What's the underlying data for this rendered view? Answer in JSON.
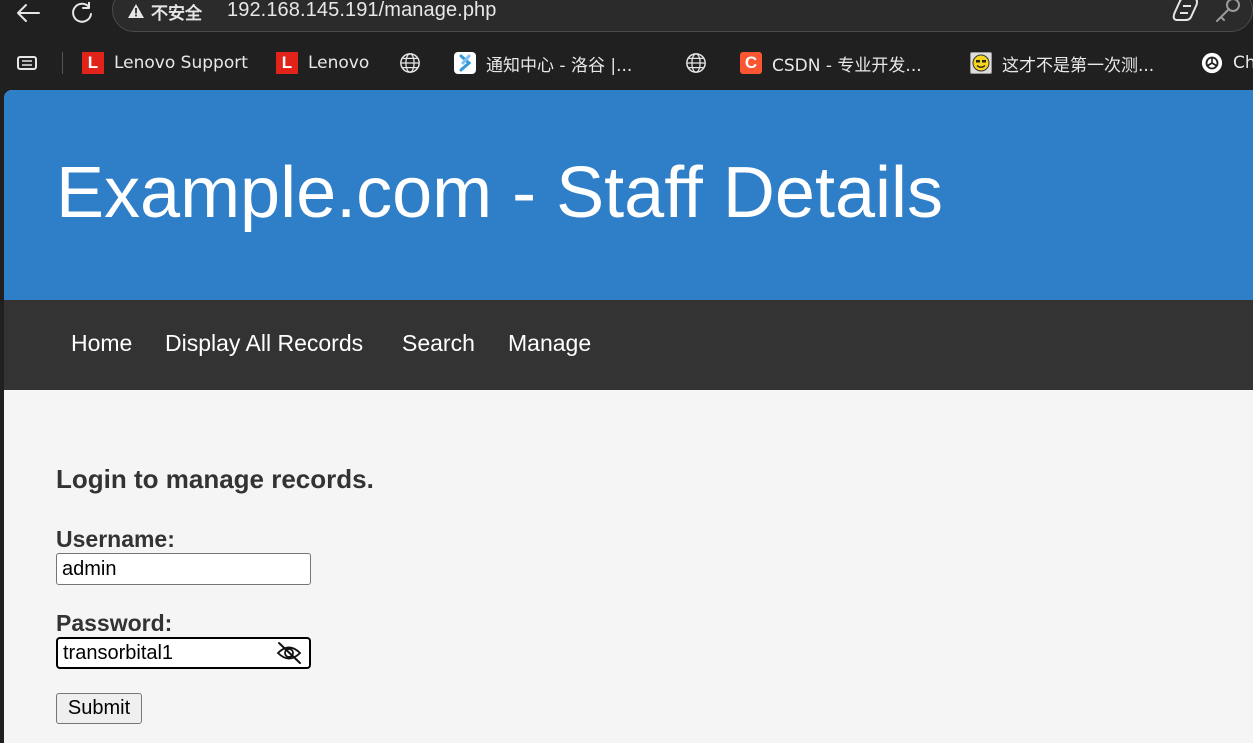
{
  "browser": {
    "security_label": "不安全",
    "url": "192.168.145.191/manage.php",
    "icons": {
      "back": "back-arrow-icon",
      "reload": "reload-icon",
      "warning": "warning-triangle-icon",
      "copilot": "copilot-icon",
      "password_key": "key-icon"
    }
  },
  "bookmarks": [
    {
      "label": "Lenovo Support",
      "icon": "lenovo-favicon"
    },
    {
      "label": "Lenovo",
      "icon": "lenovo-favicon"
    },
    {
      "label": "",
      "icon": "globe-icon"
    },
    {
      "label": "通知中心 - 洛谷 |...",
      "icon": "luogu-favicon"
    },
    {
      "label": "",
      "icon": "globe-icon"
    },
    {
      "label": "CSDN - 专业开发...",
      "icon": "csdn-favicon"
    },
    {
      "label": "这才不是第一次测...",
      "icon": "smiley-favicon"
    },
    {
      "label": "Ch",
      "icon": "chatgpt-icon"
    }
  ],
  "site": {
    "title": "Example.com - Staff Details",
    "nav": [
      "Home",
      "Display All Records",
      "Search",
      "Manage"
    ]
  },
  "login": {
    "heading": "Login to manage records.",
    "username_label": "Username:",
    "username_value": "admin",
    "password_label": "Password:",
    "password_value": "transorbital1",
    "submit_label": "Submit"
  },
  "colors": {
    "header_bg": "#2e7ec8",
    "nav_bg": "#333333",
    "page_bg": "#f5f5f5",
    "chrome_bg": "#202020"
  }
}
